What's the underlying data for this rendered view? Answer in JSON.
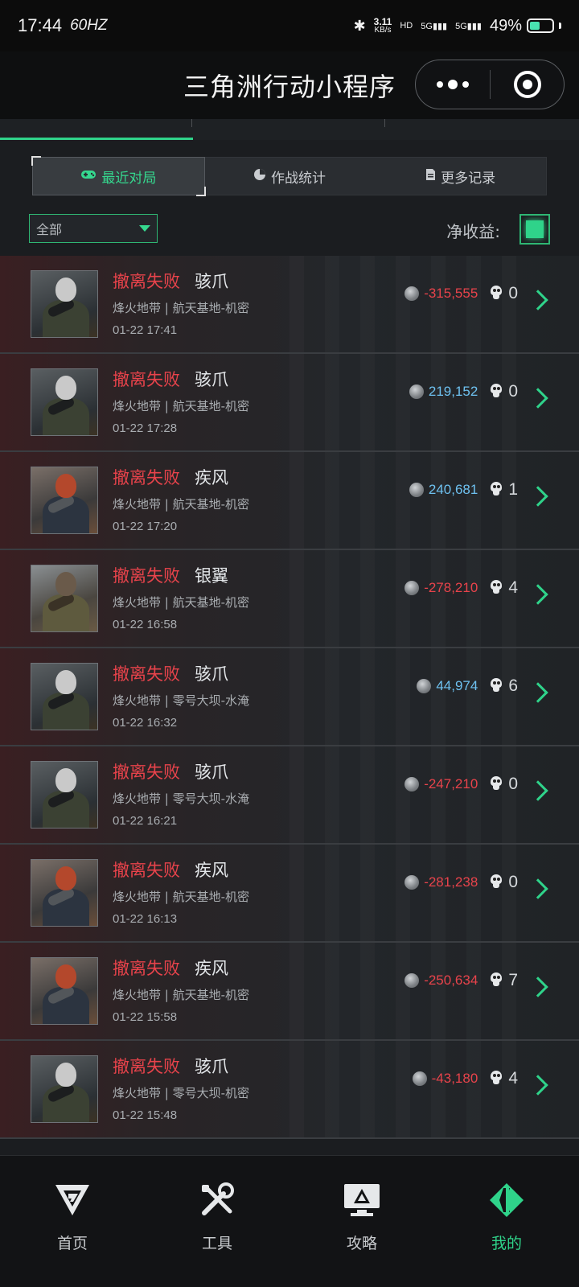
{
  "status_bar": {
    "time": "17:44",
    "refresh": "60HZ",
    "net_speed_value": "3.11",
    "net_speed_unit": "KB/s",
    "hd_label": "HD",
    "signal1": "5G",
    "signal2": "5G",
    "battery": "49%",
    "battery_level": 0.49
  },
  "header": {
    "title": "三角洲行动小程序"
  },
  "sub_tabs": [
    {
      "label": "最近对局",
      "icon": "gamepad-icon"
    },
    {
      "label": "作战统计",
      "icon": "pie-chart-icon"
    },
    {
      "label": "更多记录",
      "icon": "document-icon"
    }
  ],
  "filter": {
    "selected": "全部",
    "net_label": "净收益:"
  },
  "records": [
    {
      "status": "撤离失败",
      "operator": "骇爪",
      "map": "烽火地带 | 航天基地-机密",
      "time": "01-22 17:41",
      "value": "-315,555",
      "sign": "neg",
      "kills": "0",
      "avatar": "gray"
    },
    {
      "status": "撤离失败",
      "operator": "骇爪",
      "map": "烽火地带 | 航天基地-机密",
      "time": "01-22 17:28",
      "value": "219,152",
      "sign": "pos",
      "kills": "0",
      "avatar": "gray"
    },
    {
      "status": "撤离失败",
      "operator": "疾风",
      "map": "烽火地带 | 航天基地-机密",
      "time": "01-22 17:20",
      "value": "240,681",
      "sign": "pos",
      "kills": "1",
      "avatar": "red"
    },
    {
      "status": "撤离失败",
      "operator": "银翼",
      "map": "烽火地带 | 航天基地-机密",
      "time": "01-22 16:58",
      "value": "-278,210",
      "sign": "neg",
      "kills": "4",
      "avatar": "olive"
    },
    {
      "status": "撤离失败",
      "operator": "骇爪",
      "map": "烽火地带 | 零号大坝-水淹",
      "time": "01-22 16:32",
      "value": "44,974",
      "sign": "pos",
      "kills": "6",
      "avatar": "gray"
    },
    {
      "status": "撤离失败",
      "operator": "骇爪",
      "map": "烽火地带 | 零号大坝-水淹",
      "time": "01-22 16:21",
      "value": "-247,210",
      "sign": "neg",
      "kills": "0",
      "avatar": "gray"
    },
    {
      "status": "撤离失败",
      "operator": "疾风",
      "map": "烽火地带 | 航天基地-机密",
      "time": "01-22 16:13",
      "value": "-281,238",
      "sign": "neg",
      "kills": "0",
      "avatar": "red"
    },
    {
      "status": "撤离失败",
      "operator": "疾风",
      "map": "烽火地带 | 航天基地-机密",
      "time": "01-22 15:58",
      "value": "-250,634",
      "sign": "neg",
      "kills": "7",
      "avatar": "red"
    },
    {
      "status": "撤离失败",
      "operator": "骇爪",
      "map": "烽火地带 | 零号大坝-机密",
      "time": "01-22 15:48",
      "value": "-43,180",
      "sign": "neg",
      "kills": "4",
      "avatar": "gray"
    }
  ],
  "bottom_nav": [
    {
      "label": "首页",
      "icon": "home-logo-icon"
    },
    {
      "label": "工具",
      "icon": "tools-icon"
    },
    {
      "label": "攻略",
      "icon": "guide-monitor-icon"
    },
    {
      "label": "我的",
      "icon": "profile-logo-icon"
    }
  ],
  "colors": {
    "accent": "#2fd38a",
    "negative": "#e8434b",
    "positive": "#6ec1f0"
  }
}
